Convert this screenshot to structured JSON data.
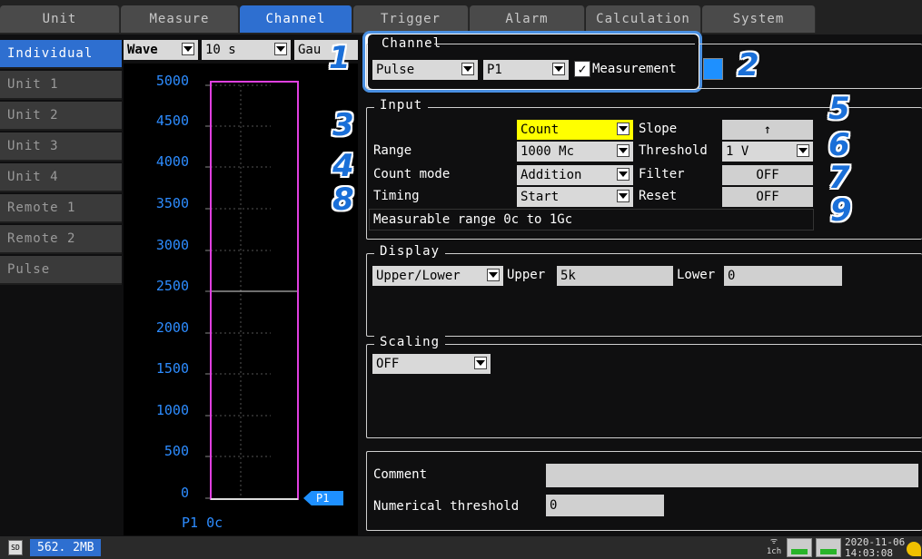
{
  "tabs": [
    "Unit",
    "Measure",
    "Channel",
    "Trigger",
    "Alarm",
    "Calculation",
    "System"
  ],
  "sidebar": [
    "Individual",
    "Unit 1",
    "Unit 2",
    "Unit 3",
    "Unit 4",
    "Remote 1",
    "Remote 2",
    "Pulse"
  ],
  "toolbar": {
    "view": "Wave",
    "time": "10 s",
    "mode": "Gau"
  },
  "graph": {
    "yticks": [
      "5000",
      "4500",
      "4000",
      "3500",
      "3000",
      "2500",
      "2000",
      "1500",
      "1000",
      "500",
      "0"
    ],
    "marker": "P1",
    "readout": "P1 0c"
  },
  "channel": {
    "title": "Channel",
    "type": "Pulse",
    "ch": "P1",
    "measurement_label": "Measurement",
    "measurement_checked": true,
    "color": "#1e90ff"
  },
  "input": {
    "title": "Input",
    "input_type": "Count",
    "slope_label": "Slope",
    "slope": "↑",
    "range_label": "Range",
    "range": "1000 Mc",
    "threshold_label": "Threshold",
    "threshold": "1 V",
    "countmode_label": "Count mode",
    "countmode": "Addition",
    "filter_label": "Filter",
    "filter": "OFF",
    "timing_label": "Timing",
    "timing": "Start",
    "reset_label": "Reset",
    "reset": "OFF",
    "measurable": "Measurable range 0c to 1Gc"
  },
  "display": {
    "title": "Display",
    "mode": "Upper/Lower",
    "upper_label": "Upper",
    "upper": "5k",
    "lower_label": "Lower",
    "lower": "0"
  },
  "scaling": {
    "title": "Scaling",
    "value": "OFF"
  },
  "bottom": {
    "comment_label": "Comment",
    "comment": "",
    "numthr_label": "Numerical threshold",
    "numthr": "0"
  },
  "callouts": [
    "1",
    "2",
    "3",
    "4",
    "5",
    "6",
    "7",
    "8",
    "9"
  ],
  "status": {
    "storage": "562. 2MB",
    "ch": "1ch",
    "date": "2020-11-06",
    "time": "14:03:08"
  }
}
